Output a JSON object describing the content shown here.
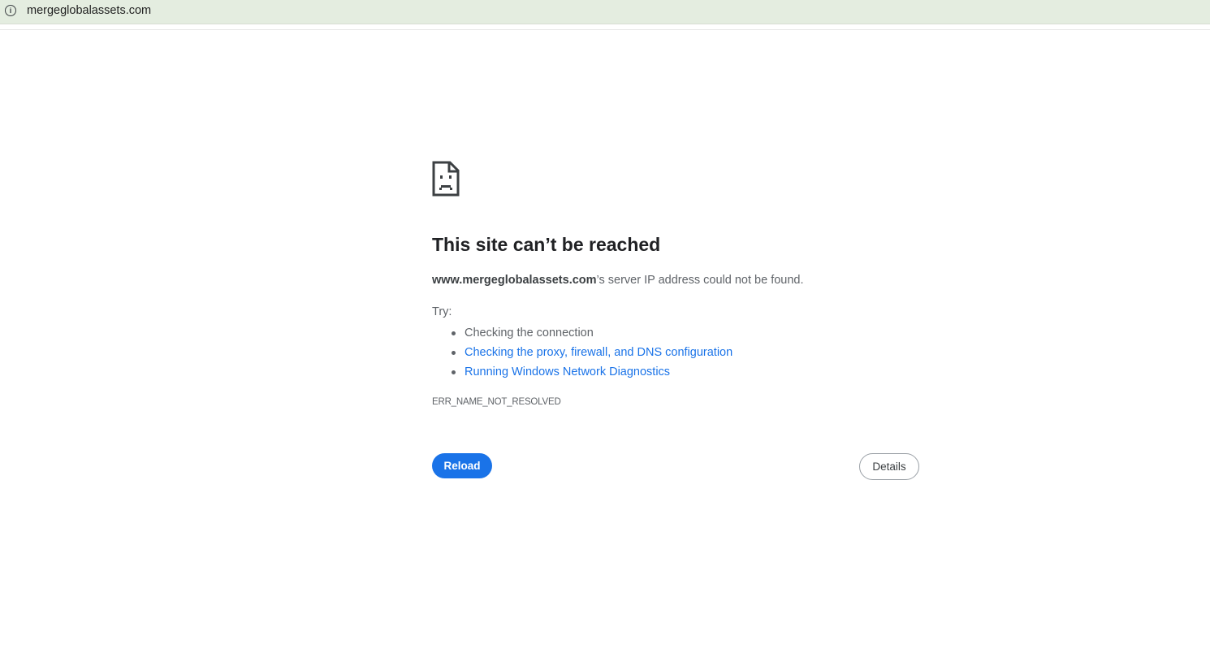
{
  "addressbar": {
    "icon": "info-icon",
    "icon_glyph": "i",
    "url": "mergeglobalassets.com"
  },
  "error": {
    "icon": "sad-page-icon",
    "title": "This site can’t be reached",
    "host": "www.mergeglobalassets.com",
    "message_suffix": "’s server IP address could not be found.",
    "try_label": "Try:",
    "suggestions": [
      {
        "text": "Checking the connection",
        "link": false
      },
      {
        "text": "Checking the proxy, firewall, and DNS configuration",
        "link": true
      },
      {
        "text": "Running Windows Network Diagnostics",
        "link": true
      }
    ],
    "code": "ERR_NAME_NOT_RESOLVED"
  },
  "buttons": {
    "reload": "Reload",
    "details": "Details"
  },
  "colors": {
    "accent": "#1a73e8",
    "addressbar_bg": "#e4ede0",
    "text_secondary": "#5f6368"
  }
}
